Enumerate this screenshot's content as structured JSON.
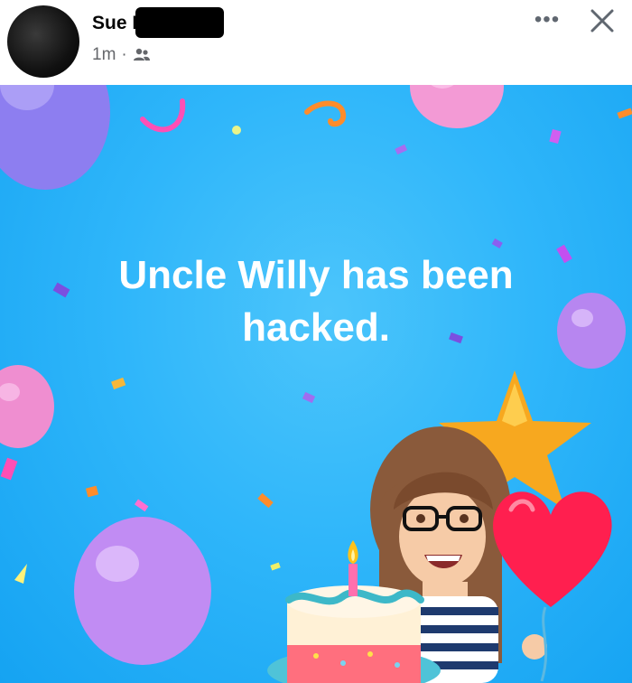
{
  "post": {
    "author": "Sue Di",
    "time": "1m",
    "separator": "·",
    "audience_icon": "friends-icon"
  },
  "controls": {
    "more_label": "•••",
    "more_icon": "more-options-icon",
    "close_icon": "close-icon"
  },
  "card": {
    "text": "Uncle Willy has been hacked.",
    "background_color": "#2fb6fa",
    "text_color": "#ffffff"
  }
}
